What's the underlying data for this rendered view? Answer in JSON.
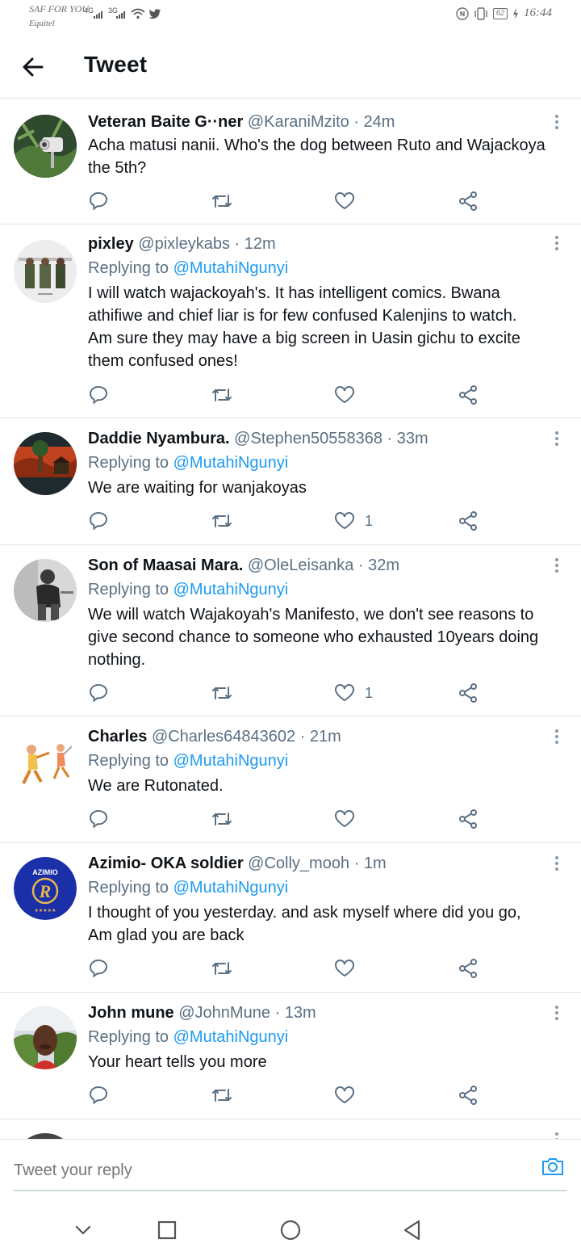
{
  "status": {
    "carrier_line1": "SAF FOR YOU",
    "carrier_line2": "Equitel",
    "sig1": "4G",
    "sig2": "3G",
    "battery": "62",
    "time": "16:44",
    "icons": [
      "signal-icon",
      "wifi-icon",
      "twitter-icon",
      "nfc-icon",
      "vibrate-icon",
      "battery-icon",
      "charging-icon"
    ]
  },
  "header": {
    "title": "Tweet"
  },
  "tweets": [
    {
      "name": "Veteran Baite G··ner",
      "handle": "@KaraniMzito · 24m",
      "replying_label": "",
      "replying_to": "",
      "text": [
        "Acha matusi nanii.  Who's the dog between Ruto and Wajackoya",
        "the 5th?"
      ],
      "likes": ""
    },
    {
      "name": "pixley",
      "handle": "@pixleykabs · 12m",
      "replying_label": "Replying to",
      "replying_to": "@MutahiNgunyi",
      "text": [
        "I will watch wajackoyah's. It has intelligent comics. Bwana",
        "athifiwe and chief liar is for few confused Kalenjins to watch.",
        "Am sure they may have a big screen in Uasin gichu to excite",
        "them confused ones!"
      ],
      "likes": ""
    },
    {
      "name": "Daddie Nyambura.",
      "handle": "@Stephen50558368 · 33m",
      "replying_label": "Replying to",
      "replying_to": "@MutahiNgunyi",
      "text": [
        "We are waiting for wanjakoyas"
      ],
      "likes": "1"
    },
    {
      "name": "Son of Maasai Mara.",
      "handle": "@OleLeisanka · 32m",
      "replying_label": "Replying to",
      "replying_to": "@MutahiNgunyi",
      "text": [
        "We will watch Wajakoyah's Manifesto, we don't see reasons to",
        "give second chance to someone who exhausted 10years doing",
        "nothing."
      ],
      "likes": "1"
    },
    {
      "name": "Charles",
      "handle": "@Charles64843602 · 21m",
      "replying_label": "Replying to",
      "replying_to": "@MutahiNgunyi",
      "text": [
        "We are Rutonated."
      ],
      "likes": ""
    },
    {
      "name": "Azimio- OKA soldier",
      "handle": "@Colly_mooh · 1m",
      "replying_label": "Replying to",
      "replying_to": "@MutahiNgunyi",
      "text": [
        "I thought of you yesterday. and ask myself where did you go,",
        "Am glad you are back"
      ],
      "likes": ""
    },
    {
      "name": "John mune",
      "handle": "@JohnMune · 13m",
      "replying_label": "Replying to",
      "replying_to": "@MutahiNgunyi",
      "text": [
        "Your heart tells you more"
      ],
      "likes": ""
    }
  ],
  "azimio_logo_text": "AZIMIO",
  "azimio_logo_letter": "R",
  "reply": {
    "placeholder": "Tweet your reply"
  },
  "colors": {
    "accent": "#1d9bf0",
    "muted": "#5b7083",
    "divider": "#e1e5e8"
  }
}
